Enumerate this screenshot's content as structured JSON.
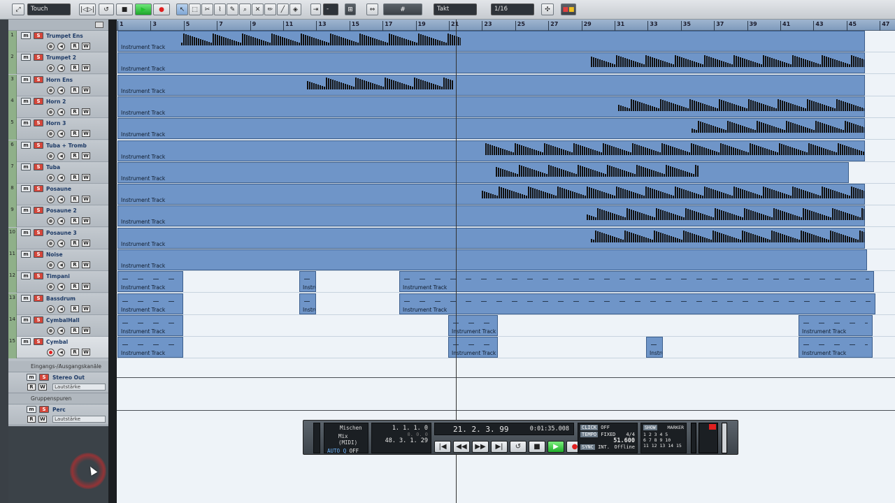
{
  "toolbar": {
    "automation_mode": "Touch",
    "grid_type": "Takt",
    "quantize": "1/16",
    "colors": {
      "play": "#22c32e",
      "record": "#e02020",
      "bg": "#d3d7db"
    }
  },
  "ruler": {
    "ticks": [
      "1",
      "3",
      "5",
      "7",
      "9",
      "11",
      "13",
      "15",
      "17",
      "19",
      "21",
      "23",
      "25",
      "27",
      "29",
      "31",
      "33",
      "35",
      "37",
      "39",
      "41",
      "43",
      "45",
      "47"
    ]
  },
  "tracks": [
    {
      "num": "1",
      "name": "Trumpet Ens",
      "mute": "m",
      "solo": "S",
      "read": "R",
      "write": "W"
    },
    {
      "num": "2",
      "name": "Trumpet 2",
      "mute": "m",
      "solo": "S",
      "read": "R",
      "write": "W"
    },
    {
      "num": "3",
      "name": "Horn Ens",
      "mute": "m",
      "solo": "S",
      "read": "R",
      "write": "W"
    },
    {
      "num": "4",
      "name": "Horn 2",
      "mute": "m",
      "solo": "S",
      "read": "R",
      "write": "W"
    },
    {
      "num": "5",
      "name": "Horn 3",
      "mute": "m",
      "solo": "S",
      "read": "R",
      "write": "W"
    },
    {
      "num": "6",
      "name": "Tuba + Tromb",
      "mute": "m",
      "solo": "S",
      "read": "R",
      "write": "W"
    },
    {
      "num": "7",
      "name": "Tuba",
      "mute": "m",
      "solo": "S",
      "read": "R",
      "write": "W"
    },
    {
      "num": "8",
      "name": "Posaune",
      "mute": "m",
      "solo": "S",
      "read": "R",
      "write": "W"
    },
    {
      "num": "9",
      "name": "Posaune 2",
      "mute": "m",
      "solo": "S",
      "read": "R",
      "write": "W"
    },
    {
      "num": "10",
      "name": "Posaune 3",
      "mute": "m",
      "solo": "S",
      "read": "R",
      "write": "W"
    },
    {
      "num": "11",
      "name": "Noise",
      "mute": "m",
      "solo": "S",
      "read": "R",
      "write": "W"
    },
    {
      "num": "12",
      "name": "Timpani",
      "mute": "m",
      "solo": "S",
      "read": "R",
      "write": "W"
    },
    {
      "num": "13",
      "name": "Bassdrum",
      "mute": "m",
      "solo": "S",
      "read": "R",
      "write": "W"
    },
    {
      "num": "14",
      "name": "CymbalHall",
      "mute": "m",
      "solo": "S",
      "read": "R",
      "write": "W"
    },
    {
      "num": "15",
      "name": "Cymbal",
      "mute": "m",
      "solo": "S",
      "read": "R",
      "write": "W"
    }
  ],
  "part_label": "Instrument Track",
  "part_label_short": "Instru",
  "folders": {
    "inout": "Eingangs-/Ausgangskanäle",
    "group": "Gruppenspuren"
  },
  "fx_tracks": [
    {
      "name": "Stereo Out",
      "param": "Lautstärke",
      "mute": "m",
      "solo": "S",
      "read": "R",
      "write": "W"
    },
    {
      "name": "Perc",
      "param": "Lautstärke",
      "mute": "m",
      "solo": "S",
      "read": "R",
      "write": "W"
    }
  ],
  "transport": {
    "mixer_label": "Mischen",
    "mix_midi": "Mix (MIDI)",
    "auto_q": "AUTO Q",
    "auto_q_state": "OFF",
    "left_locator": "1. 1. 1.   0",
    "right_locator": "48. 3. 1. 29",
    "position_bars": "21. 2. 3. 99",
    "position_time": "0:01:35.008",
    "click_label": "CLICK",
    "click_state": "OFF",
    "tempo_label": "TEMPO",
    "tempo_mode": "FIXED",
    "signature": "4/4",
    "tempo_value": "51.600",
    "sync_label": "SYNC",
    "sync_mode": "INT.",
    "sync_state": "Offline",
    "show_label": "SHOW",
    "marker_label": "MARKER",
    "marker_row1": "1  2  3  4  5",
    "marker_row2": "6  7  8  9  10",
    "marker_row3": "11 12 13 14 15"
  }
}
